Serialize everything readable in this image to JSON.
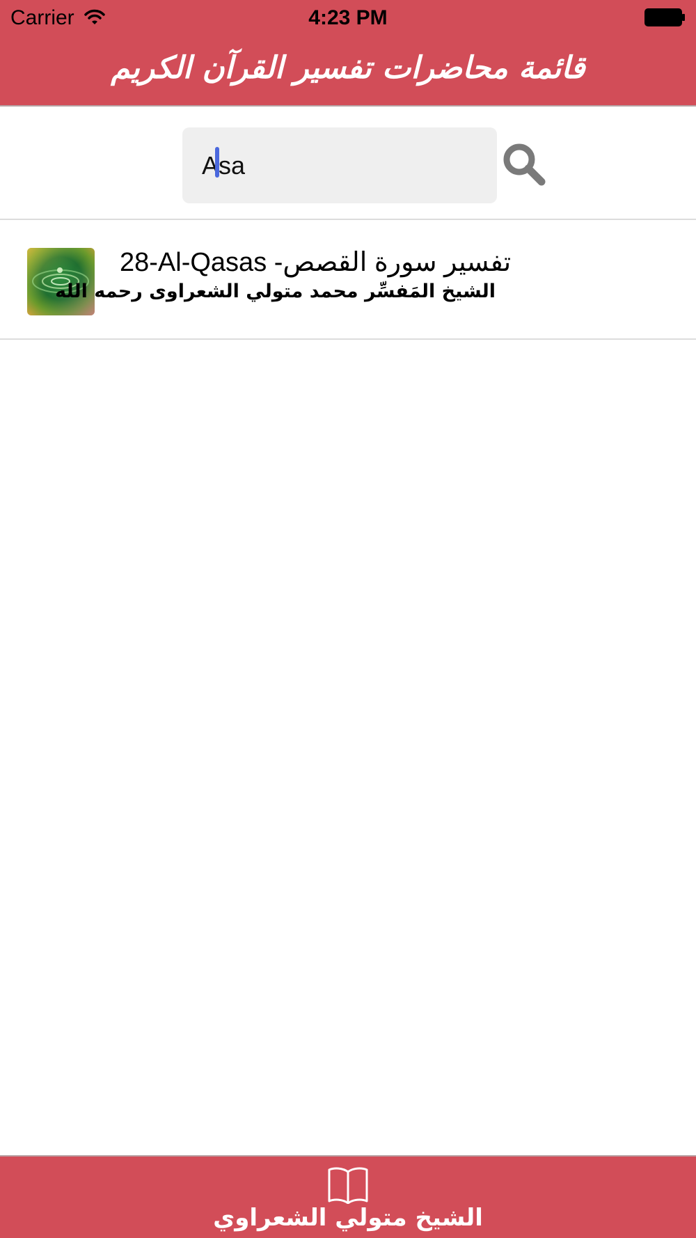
{
  "status_bar": {
    "carrier": "Carrier",
    "time": "4:23 PM"
  },
  "nav": {
    "title": "قائمة محاضرات تفسير القرآن الكريم"
  },
  "search": {
    "value": "Asa",
    "icon": "search-icon"
  },
  "results": [
    {
      "title": "28-Al-Qasas -تفسير سورة القصص",
      "subtitle": "الشيخ المَفسِّر محمد متولي الشعراوى رحمه الله",
      "thumbnail": "water-drop-image"
    }
  ],
  "tab_bar": {
    "items": [
      {
        "label": "الشيخ متولي الشعراوي",
        "icon": "book-icon"
      }
    ]
  },
  "colors": {
    "accent": "#d24d58",
    "cursor": "#4a68dd",
    "search_bg": "#efefef"
  }
}
